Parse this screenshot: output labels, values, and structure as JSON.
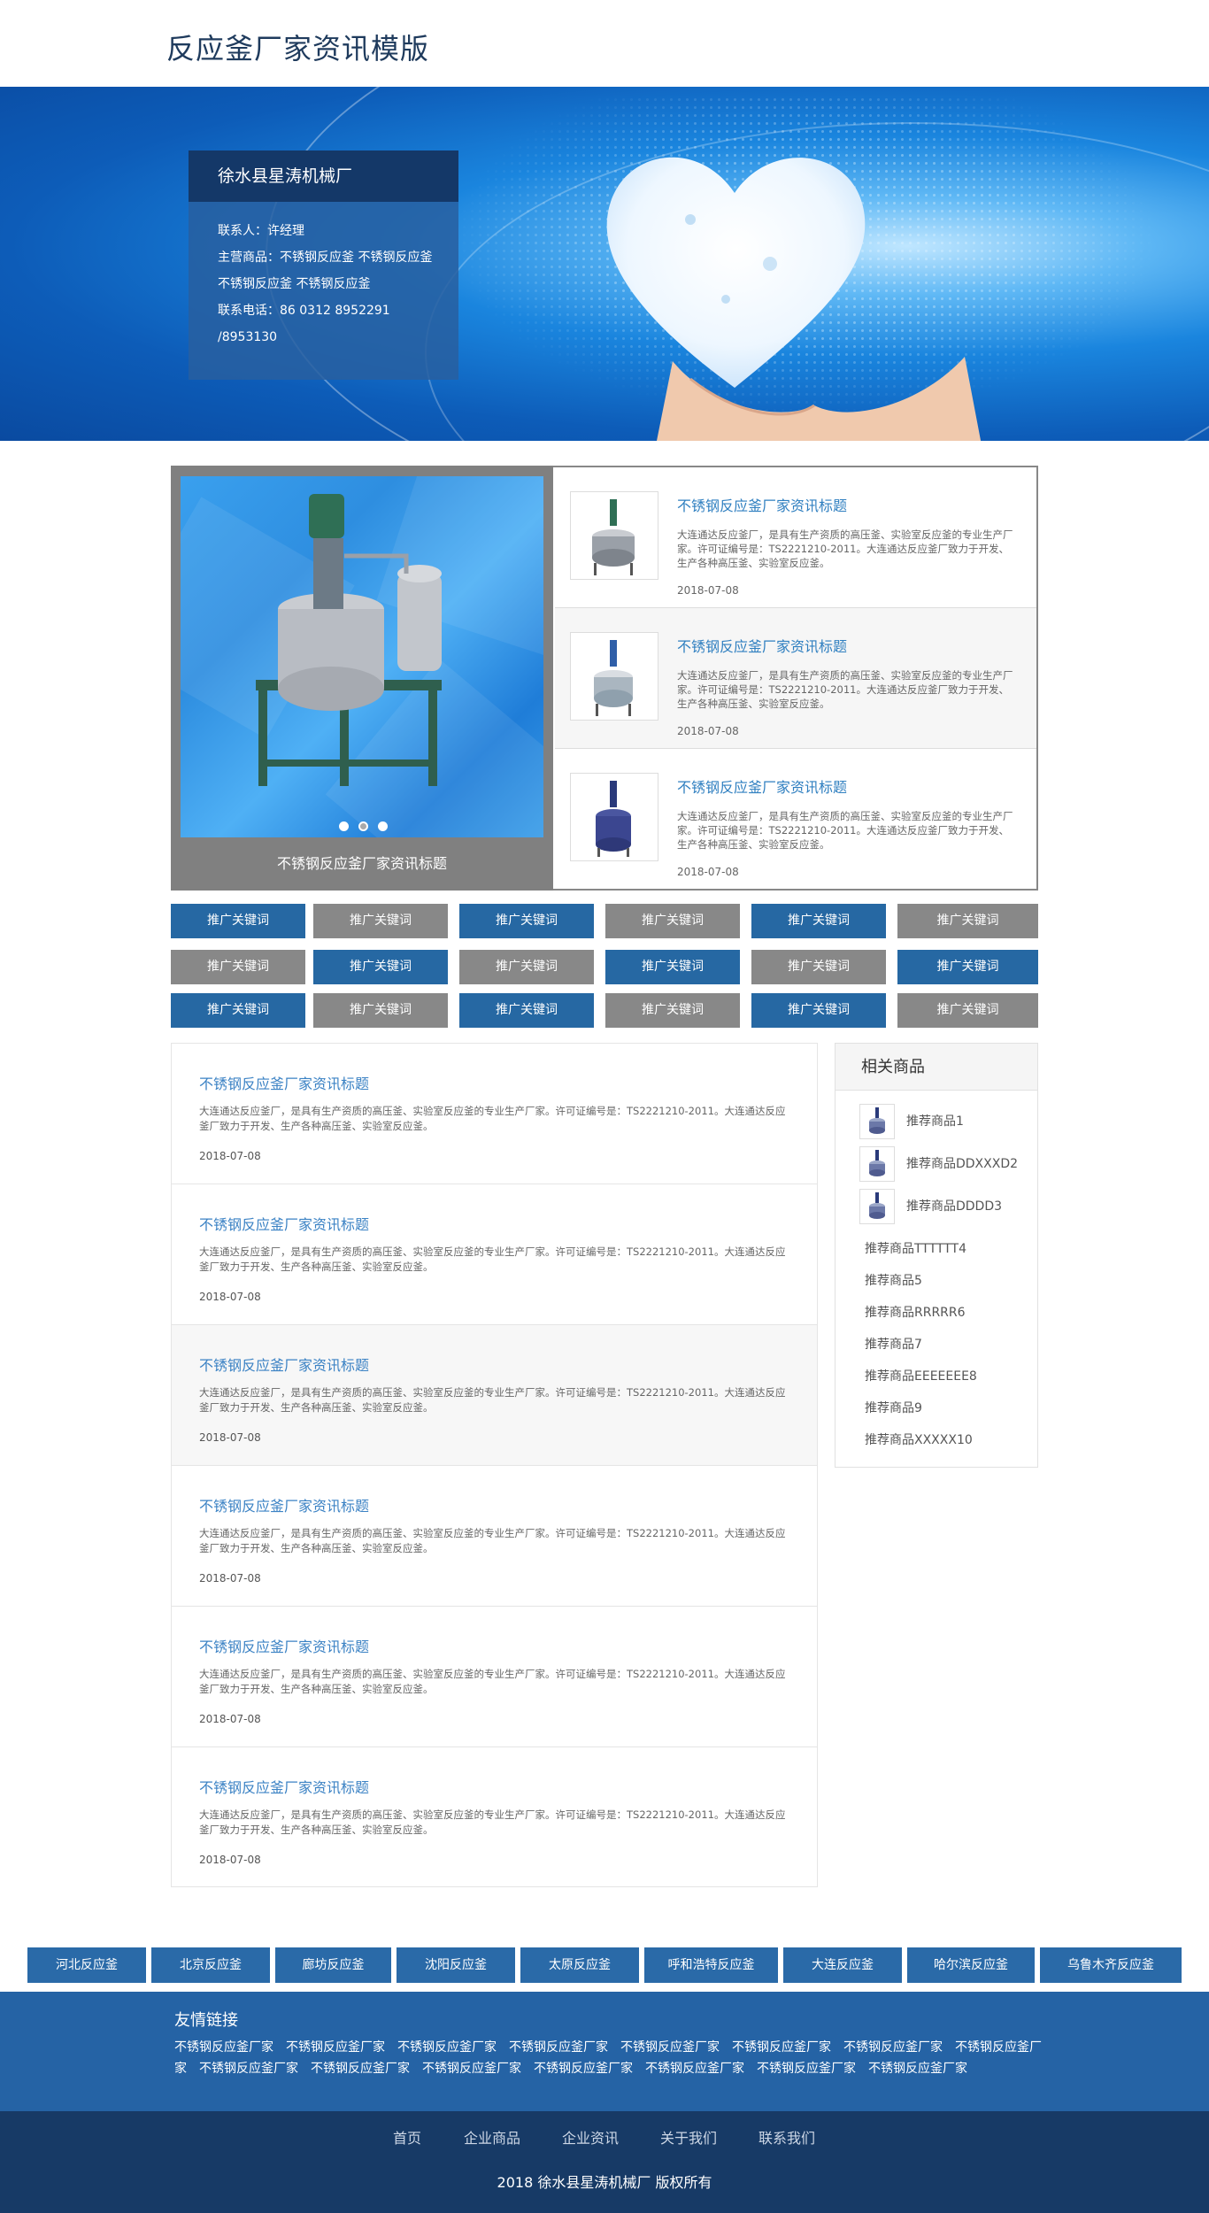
{
  "header": {
    "title": "反应釜厂家资讯模版"
  },
  "company": {
    "name": "徐水县星涛机械厂",
    "lines": [
      "联系人：许经理",
      "主营商品：不锈钢反应釜  不锈钢反应釜",
      "不锈钢反应釜  不锈钢反应釜",
      "联系电话：86 0312 8952291",
      "/8953130"
    ]
  },
  "slider": {
    "caption": "不锈钢反应釜厂家资讯标题",
    "dots": 3
  },
  "featured_news": [
    {
      "title": "不锈钢反应釜厂家资讯标题",
      "desc": "大连通达反应釜厂，是具有生产资质的高压釜、实验室反应釜的专业生产厂家。许可证编号是：TS2221210-2011。大连通达反应釜厂致力于开发、生产各种高压釜、实验室反应釜。",
      "date": "2018-07-08"
    },
    {
      "title": "不锈钢反应釜厂家资讯标题",
      "desc": "大连通达反应釜厂，是具有生产资质的高压釜、实验室反应釜的专业生产厂家。许可证编号是：TS2221210-2011。大连通达反应釜厂致力于开发、生产各种高压釜、实验室反应釜。",
      "date": "2018-07-08"
    },
    {
      "title": "不锈钢反应釜厂家资讯标题",
      "desc": "大连通达反应釜厂，是具有生产资质的高压釜、实验室反应釜的专业生产厂家。许可证编号是：TS2221210-2011。大连通达反应釜厂致力于开发、生产各种高压釜、实验室反应釜。",
      "date": "2018-07-08"
    }
  ],
  "keywords": [
    [
      "推广关键词",
      "推广关键词",
      "推广关键词",
      "推广关键词",
      "推广关键词",
      "推广关键词"
    ],
    [
      "推广关键词",
      "推广关键词",
      "推广关键词",
      "推广关键词",
      "推广关键词",
      "推广关键词"
    ],
    [
      "推广关键词",
      "推广关键词",
      "推广关键词",
      "推广关键词",
      "推广关键词",
      "推广关键词"
    ]
  ],
  "colors": {
    "blue": "#2668a3",
    "gray": "#888888",
    "link": "#3b82c4"
  },
  "articles": [
    {
      "title": "不锈钢反应釜厂家资讯标题",
      "desc": "大连通达反应釜厂，是具有生产资质的高压釜、实验室反应釜的专业生产厂家。许可证编号是：TS2221210-2011。大连通达反应釜厂致力于开发、生产各种高压釜、实验室反应釜。",
      "date": "2018-07-08"
    },
    {
      "title": "不锈钢反应釜厂家资讯标题",
      "desc": "大连通达反应釜厂，是具有生产资质的高压釜、实验室反应釜的专业生产厂家。许可证编号是：TS2221210-2011。大连通达反应釜厂致力于开发、生产各种高压釜、实验室反应釜。",
      "date": "2018-07-08"
    },
    {
      "title": "不锈钢反应釜厂家资讯标题",
      "desc": "大连通达反应釜厂，是具有生产资质的高压釜、实验室反应釜的专业生产厂家。许可证编号是：TS2221210-2011。大连通达反应釜厂致力于开发、生产各种高压釜、实验室反应釜。",
      "date": "2018-07-08"
    },
    {
      "title": "不锈钢反应釜厂家资讯标题",
      "desc": "大连通达反应釜厂，是具有生产资质的高压釜、实验室反应釜的专业生产厂家。许可证编号是：TS2221210-2011。大连通达反应釜厂致力于开发、生产各种高压釜、实验室反应釜。",
      "date": "2018-07-08"
    },
    {
      "title": "不锈钢反应釜厂家资讯标题",
      "desc": "大连通达反应釜厂，是具有生产资质的高压釜、实验室反应釜的专业生产厂家。许可证编号是：TS2221210-2011。大连通达反应釜厂致力于开发、生产各种高压釜、实验室反应釜。",
      "date": "2018-07-08"
    },
    {
      "title": "不锈钢反应釜厂家资讯标题",
      "desc": "大连通达反应釜厂，是具有生产资质的高压釜、实验室反应釜的专业生产厂家。许可证编号是：TS2221210-2011。大连通达反应釜厂致力于开发、生产各种高压釜、实验室反应釜。",
      "date": "2018-07-08"
    }
  ],
  "related": {
    "title": "相关商品",
    "with_image": [
      "推荐商品1",
      "推荐商品DDXXXD2",
      "推荐商品DDDD3"
    ],
    "plain": [
      "推荐商品TTTTTT4",
      "推荐商品5",
      "推荐商品RRRRR6",
      "推荐商品7",
      "推荐商品EEEEEEE8",
      "推荐商品9",
      "推荐商品XXXXX10"
    ]
  },
  "cities": [
    "河北反应釜",
    "北京反应釜",
    "廊坊反应釜",
    "沈阳反应釜",
    "太原反应釜",
    "呼和浩特反应釜",
    "大连反应釜",
    "哈尔滨反应釜",
    "乌鲁木齐反应釜"
  ],
  "friend_links": {
    "title": "友情链接",
    "items": [
      "不锈钢反应釜厂家",
      "不锈钢反应釜厂家",
      "不锈钢反应釜厂家",
      "不锈钢反应釜厂家",
      "不锈钢反应釜厂家",
      "不锈钢反应釜厂家",
      "不锈钢反应釜厂家",
      "不锈钢反应釜厂家",
      "不锈钢反应釜厂家",
      "不锈钢反应釜厂家",
      "不锈钢反应釜厂家",
      "不锈钢反应釜厂家",
      "不锈钢反应釜厂家",
      "不锈钢反应釜厂家",
      "不锈钢反应釜厂家"
    ]
  },
  "footer": {
    "nav": [
      "首页",
      "企业商品",
      "企业资讯",
      "关于我们",
      "联系我们"
    ],
    "copyright": "2018 徐水县星涛机械厂 版权所有"
  }
}
